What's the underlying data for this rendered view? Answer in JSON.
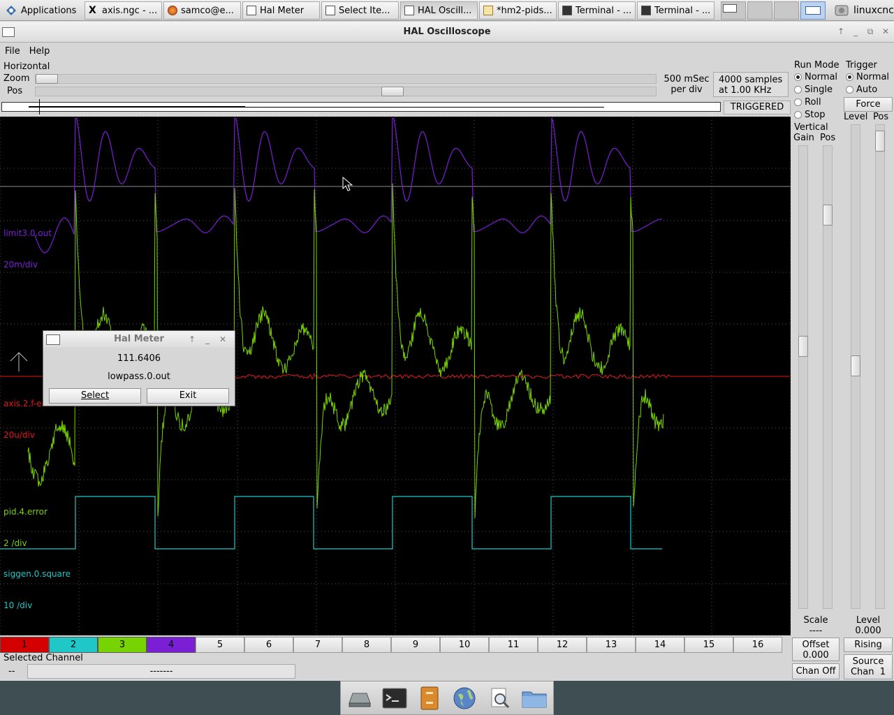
{
  "taskbar": {
    "applications_label": "Applications",
    "tasks": [
      {
        "label": "axis.ngc - ..."
      },
      {
        "label": "samco@e..."
      },
      {
        "label": "Hal Meter"
      },
      {
        "label": "Select Ite..."
      },
      {
        "label": "HAL Oscill..."
      },
      {
        "label": "*hm2-pids..."
      },
      {
        "label": "Terminal - ..."
      },
      {
        "label": "Terminal - ..."
      }
    ],
    "user": "linuxcnc"
  },
  "window": {
    "title": "HAL Oscilloscope"
  },
  "menu": {
    "file": "File",
    "help": "Help"
  },
  "horizontal": {
    "group": "Horizontal",
    "zoom_label": "Zoom",
    "pos_label": "Pos",
    "timebase_line1": "500 mSec",
    "timebase_line2": "per div",
    "samples_line1": "4000 samples",
    "samples_line2": "at 1.00 KHz",
    "status": "TRIGGERED"
  },
  "run_mode": {
    "title": "Run Mode",
    "options": [
      "Normal",
      "Single",
      "Roll",
      "Stop"
    ],
    "selected": "Normal"
  },
  "trigger": {
    "title": "Trigger",
    "options": [
      "Normal",
      "Auto"
    ],
    "selected": "Normal",
    "force": "Force",
    "level_label": "Level",
    "pos_label": "Pos",
    "level_caption": "Level",
    "level_value": "0.000",
    "edge": "Rising",
    "source_line1": "Source",
    "source_line2": "Chan  1"
  },
  "vertical": {
    "title": "Vertical",
    "gain_label": "Gain",
    "pos_label": "Pos",
    "scale_label": "Scale",
    "scale_value": "----",
    "offset_label": "Offset",
    "offset_value": "0.000",
    "chan_off": "Chan Off"
  },
  "traces": [
    {
      "name": "limit3.0.out",
      "scale": "20m/div",
      "color": "#7a1fd6"
    },
    {
      "name": "axis.2.f-error",
      "scale": "20u/div",
      "color": "#d40000"
    },
    {
      "name": "pid.4.error",
      "scale": "2 /div",
      "color": "#78d400"
    },
    {
      "name": "siggen.0.square",
      "scale": "10 /div",
      "color": "#1fc7c7"
    }
  ],
  "channels": [
    {
      "label": "1",
      "color": "#d40000"
    },
    {
      "label": "2",
      "color": "#1fc7c7"
    },
    {
      "label": "3",
      "color": "#78d400"
    },
    {
      "label": "4",
      "color": "#7a1fd6"
    },
    {
      "label": "5"
    },
    {
      "label": "6"
    },
    {
      "label": "7"
    },
    {
      "label": "8"
    },
    {
      "label": "9"
    },
    {
      "label": "10"
    },
    {
      "label": "11"
    },
    {
      "label": "12"
    },
    {
      "label": "13"
    },
    {
      "label": "14"
    },
    {
      "label": "15"
    },
    {
      "label": "16"
    }
  ],
  "selected_channel": {
    "title": "Selected Channel",
    "num": "--",
    "name": "-------"
  },
  "hal_meter": {
    "title": "Hal Meter",
    "value": "111.6406",
    "pin": "lowpass.0.out",
    "select": "Select",
    "exit": "Exit"
  },
  "dock": {
    "icons": [
      "drive-icon",
      "terminal-icon",
      "file-cabinet-icon",
      "web-browser-icon",
      "search-icon",
      "folder-icon"
    ]
  }
}
